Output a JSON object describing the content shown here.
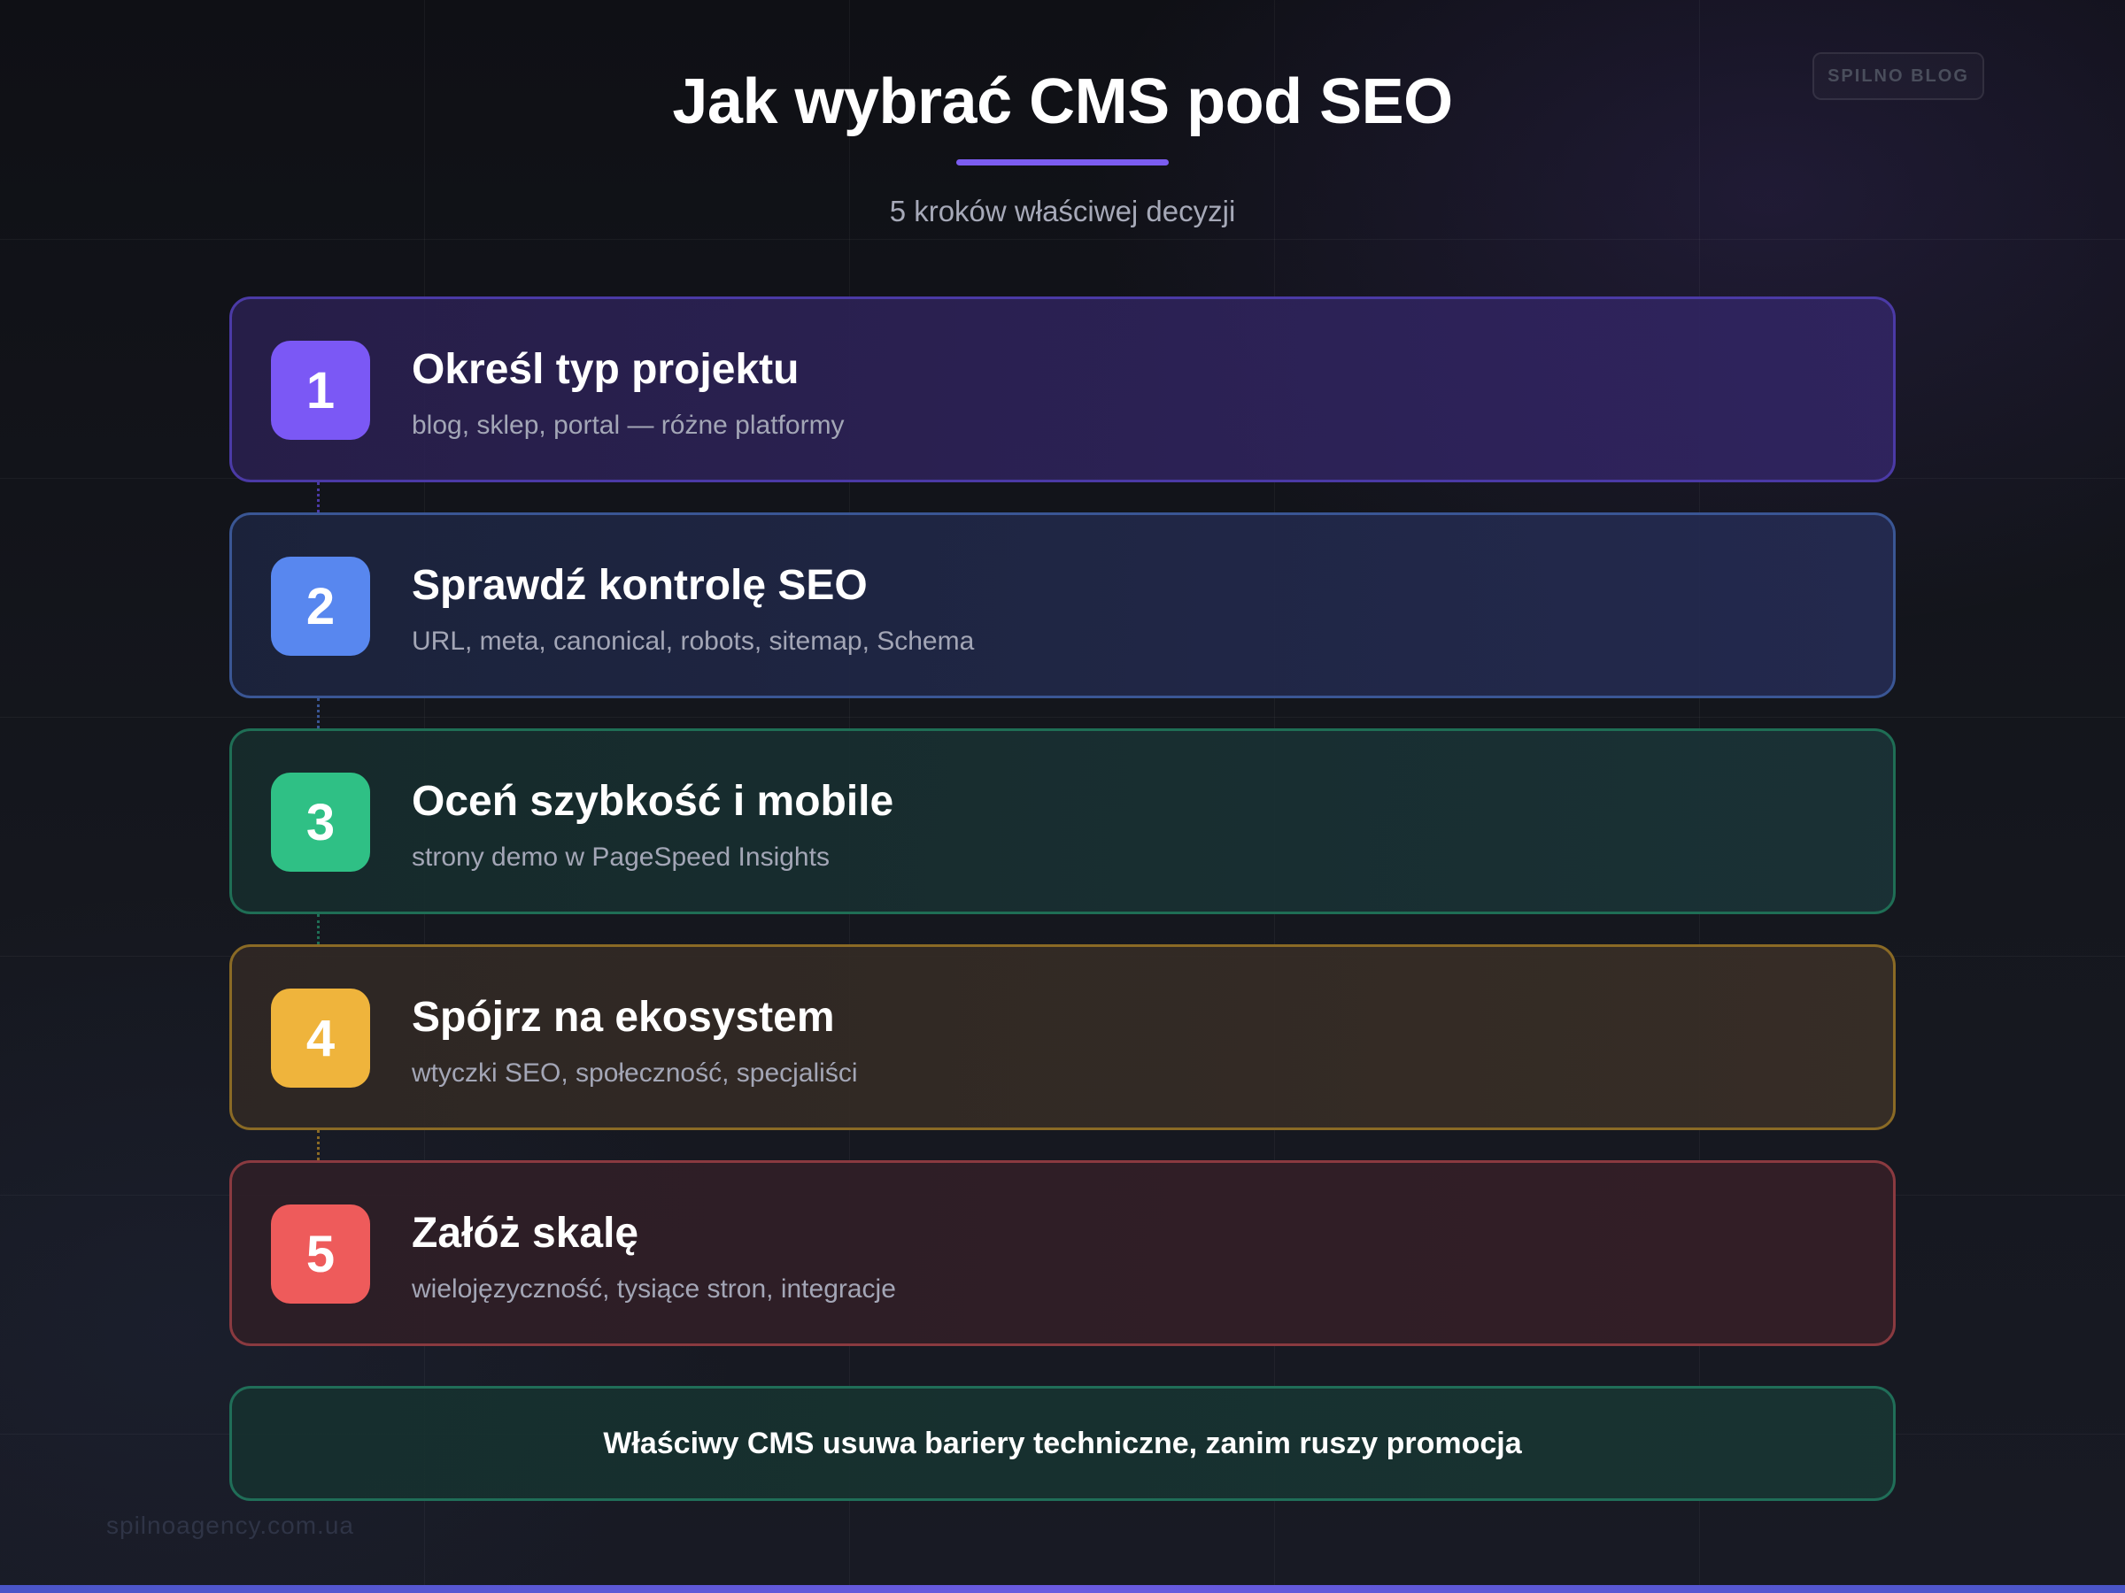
{
  "badge": "SPILNO BLOG",
  "header": {
    "title": "Jak wybrać CMS pod SEO",
    "subtitle": "5 kroków właściwej decyzji"
  },
  "steps": [
    {
      "number": "1",
      "title": "Określ typ projektu",
      "description": "blog, sklep, portal — różne platformy",
      "color": "#7b58f5"
    },
    {
      "number": "2",
      "title": "Sprawdź kontrolę SEO",
      "description": "URL, meta, canonical, robots, sitemap, Schema",
      "color": "#5887ef"
    },
    {
      "number": "3",
      "title": "Oceń szybkość i mobile",
      "description": "strony demo w PageSpeed Insights",
      "color": "#2fc085"
    },
    {
      "number": "4",
      "title": "Spójrz na ekosystem",
      "description": "wtyczki SEO, społeczność, specjaliści",
      "color": "#efb43c"
    },
    {
      "number": "5",
      "title": "Załóż skalę",
      "description": "wielojęzyczność, tysiące stron, integracje",
      "color": "#ee5b5b"
    }
  ],
  "callout": "Właściwy CMS usuwa bariery techniczne, zanim ruszy promocja",
  "footer": {
    "url": "spilnoagency.com.ua"
  }
}
